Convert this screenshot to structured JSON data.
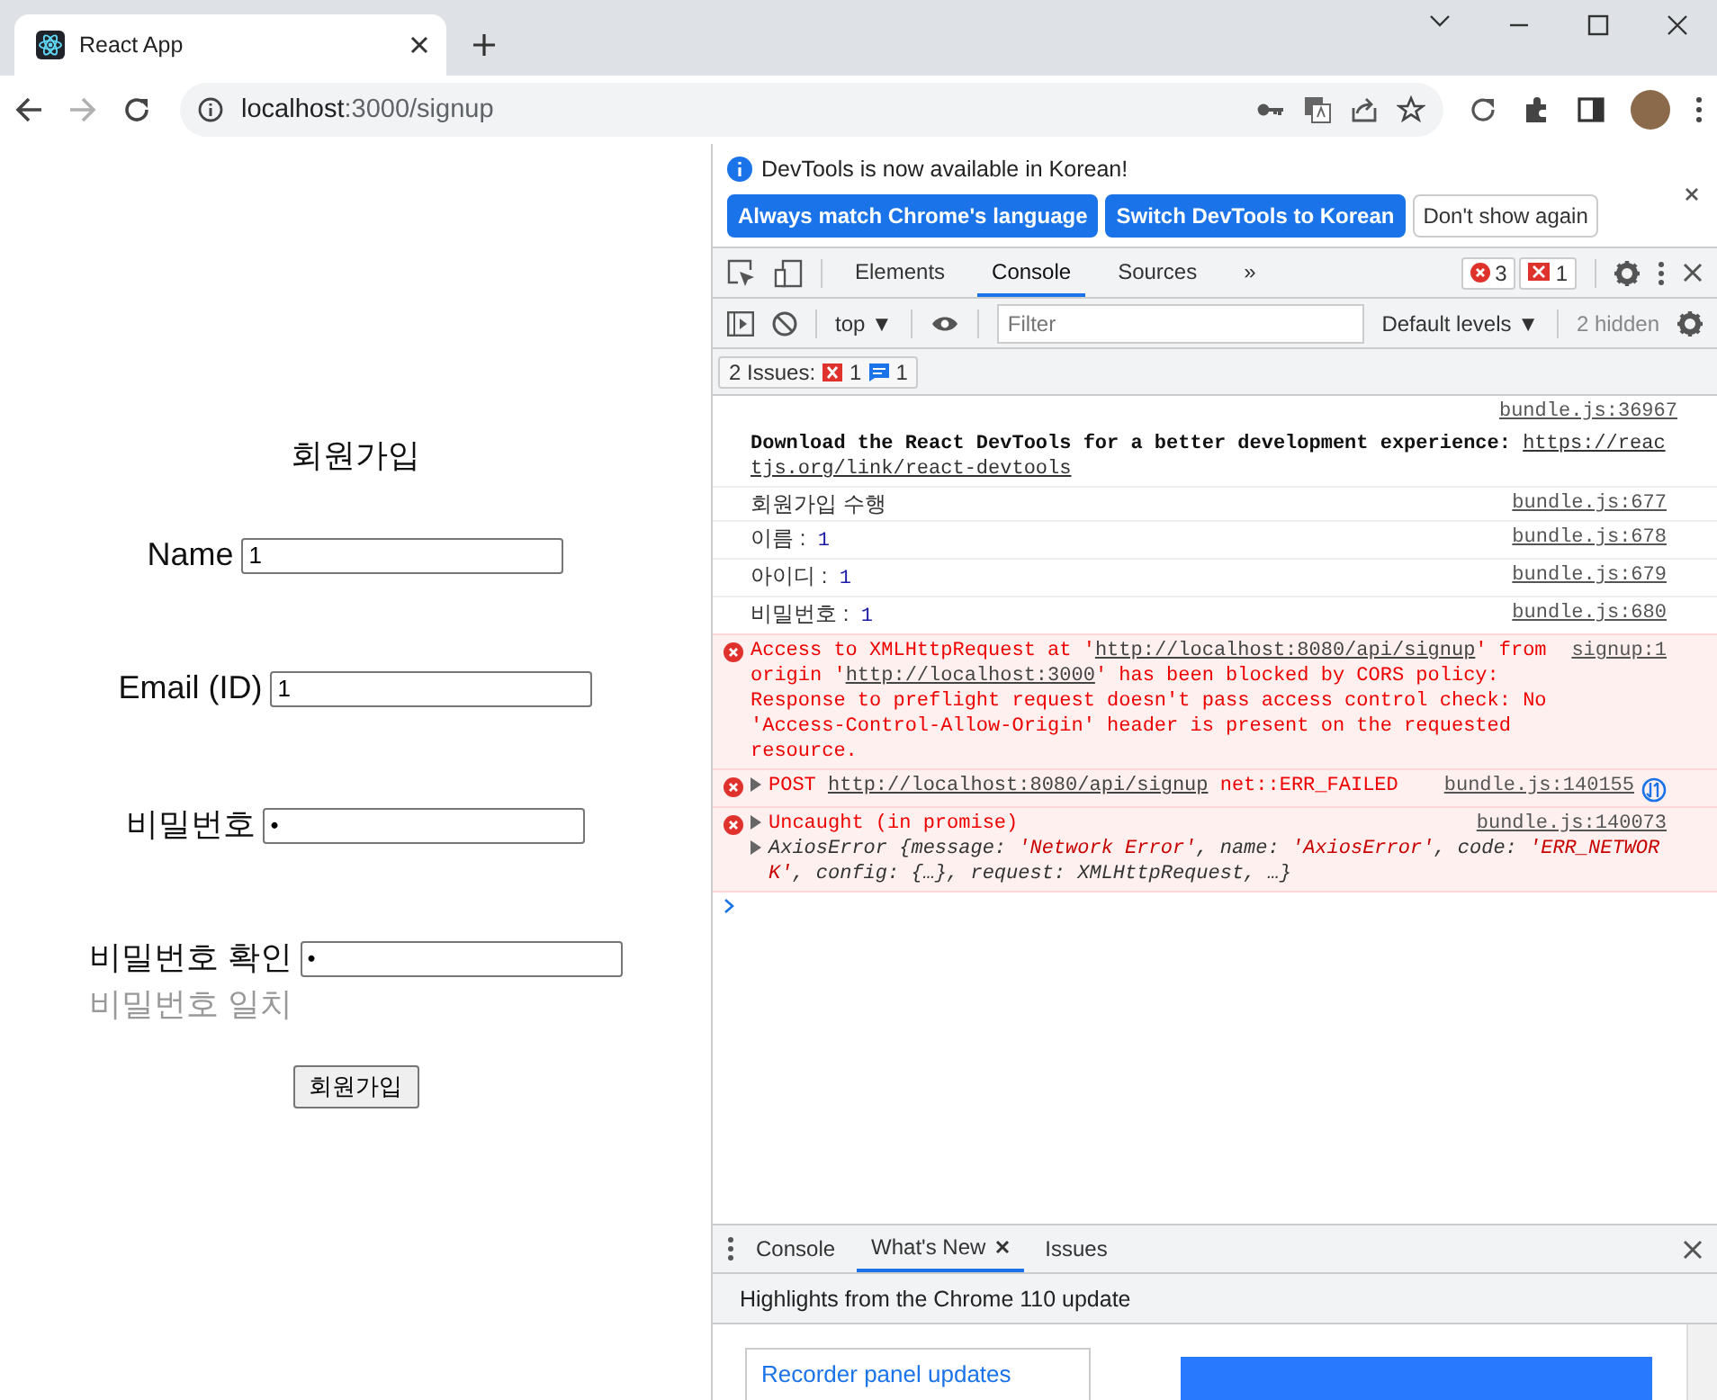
{
  "browser": {
    "tab_title": "React App",
    "url_host": "localhost",
    "url_path": ":3000/signup",
    "forward_disabled": true
  },
  "signup": {
    "title": "회원가입",
    "fields": [
      {
        "label": "Name",
        "value": "1",
        "kind": "text"
      },
      {
        "label": "Email (ID)",
        "value": "1",
        "kind": "text"
      },
      {
        "label": "비밀번호",
        "value": "•",
        "kind": "password"
      },
      {
        "label": "비밀번호 확인",
        "value": "•",
        "kind": "password",
        "note": "비밀번호 일치"
      }
    ],
    "submit": "회원가입"
  },
  "devtools": {
    "banner": {
      "message": "DevTools is now available in Korean!",
      "buttons": [
        {
          "label": "Always match Chrome's language",
          "kind": "primary"
        },
        {
          "label": "Switch DevTools to Korean",
          "kind": "primary"
        },
        {
          "label": "Don't show again",
          "kind": "secondary"
        }
      ]
    },
    "tabs": [
      {
        "label": "Elements",
        "selected": false
      },
      {
        "label": "Console",
        "selected": true
      },
      {
        "label": "Sources",
        "selected": false
      }
    ],
    "more_tabs": "»",
    "error_count": "3",
    "issue_count": "1",
    "console_toolbar": {
      "context": "top ▼",
      "filter_placeholder": "Filter",
      "levels": "Default levels ▼",
      "hidden": "2 hidden"
    },
    "issues": {
      "label": "2 Issues:",
      "errors": "1",
      "info": "1"
    },
    "messages": [
      {
        "kind": "info",
        "source": "bundle.js:36967",
        "parts": [
          {
            "kind": "bold",
            "text": "Download the React DevTools for a better development experience: "
          },
          {
            "kind": "link",
            "text": "https://reactjs.org/link/react-devtools"
          }
        ]
      },
      {
        "kind": "log",
        "source": "bundle.js:677",
        "parts": [
          {
            "kind": "plain",
            "text": "회원가입 수행"
          }
        ]
      },
      {
        "kind": "log",
        "source": "bundle.js:678",
        "parts": [
          {
            "kind": "plain",
            "text": "이름 :  "
          },
          {
            "kind": "number",
            "text": "1"
          }
        ]
      },
      {
        "kind": "log",
        "source": "bundle.js:679",
        "parts": [
          {
            "kind": "plain",
            "text": "아이디 :  "
          },
          {
            "kind": "number",
            "text": "1"
          }
        ]
      },
      {
        "kind": "log",
        "source": "bundle.js:680",
        "parts": [
          {
            "kind": "plain",
            "text": "비밀번호 :  "
          },
          {
            "kind": "number",
            "text": "1"
          }
        ]
      },
      {
        "kind": "error",
        "source": "signup:1",
        "parts": [
          {
            "kind": "plain",
            "text": "Access to XMLHttpRequest at '"
          },
          {
            "kind": "link",
            "text": "http://localhost:8080/api/signup"
          },
          {
            "kind": "plain",
            "text": "' from origin '"
          },
          {
            "kind": "link",
            "text": "http://localhost:3000"
          },
          {
            "kind": "plain",
            "text": "' has been blocked by CORS policy: Response to preflight request doesn't pass access control check: No 'Access-Control-Allow-Origin' header is present on the requested resource."
          }
        ]
      },
      {
        "kind": "error",
        "expandable": true,
        "network": true,
        "source": "bundle.js:140155",
        "parts": [
          {
            "kind": "plain",
            "text": "POST "
          },
          {
            "kind": "link",
            "text": "http://localhost:8080/api/signup"
          },
          {
            "kind": "plain",
            "text": " net::ERR_FAILED"
          }
        ]
      },
      {
        "kind": "error",
        "expandable": true,
        "source": "bundle.js:140073",
        "parts": [
          {
            "kind": "plain",
            "text": "Uncaught (in promise)"
          }
        ],
        "detail": [
          {
            "kind": "object",
            "text": "AxiosError {message: "
          },
          {
            "kind": "string",
            "text": "'Network Error'"
          },
          {
            "kind": "object",
            "text": ", name: "
          },
          {
            "kind": "string",
            "text": "'AxiosError'"
          },
          {
            "kind": "object",
            "text": ", code: "
          },
          {
            "kind": "string",
            "text": "'ERR_NETWORK'"
          },
          {
            "kind": "object",
            "text": ", config: {…}, request: XMLHttpRequest, …}"
          }
        ]
      }
    ],
    "drawer": {
      "tabs": [
        {
          "label": "Console",
          "selected": false,
          "closable": false
        },
        {
          "label": "What's New",
          "selected": true,
          "closable": true
        },
        {
          "label": "Issues",
          "selected": false,
          "closable": false
        }
      ],
      "heading": "Highlights from the Chrome 110 update",
      "card": "Recorder panel updates"
    }
  }
}
